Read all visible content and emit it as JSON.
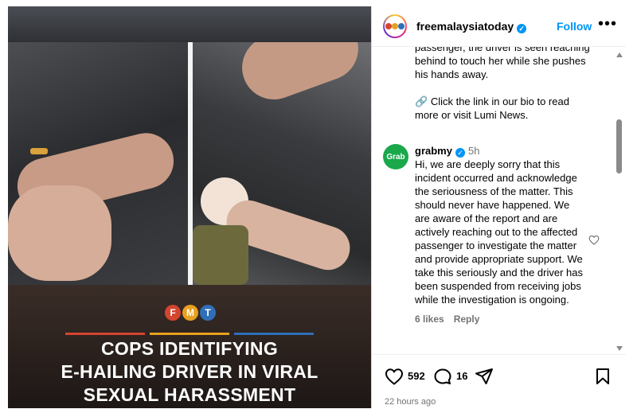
{
  "post": {
    "account": "freemalaysiatoday",
    "follow_label": "Follow",
    "more_icon": "more-horizontal-icon",
    "media": {
      "logo_letters": [
        "F",
        "M",
        "T"
      ],
      "logo_colors": [
        "#d4452f",
        "#e8a020",
        "#2f6fb8"
      ],
      "headline_lines": [
        "COPS IDENTIFYING",
        "E-HAILING DRIVER IN VIRAL",
        "SEXUAL HARASSMENT"
      ]
    },
    "caption": {
      "lines_partial": "passenger, the driver is seen reaching behind to touch her while she pushes his hands away.",
      "link_text": "Click the link in our bio to read more or visit Lumi News."
    },
    "comment": {
      "avatar_text": "Grab",
      "username": "grabmy",
      "time": "5h",
      "text": "Hi, we are deeply sorry that this incident occurred and acknowledge the seriousness of the matter. This should never have happened. We are aware of the report and are actively reaching out to the affected passenger to investigate the matter and provide appropriate support. We take this seriously and the driver has been suspended from receiving jobs while the investigation is ongoing.",
      "likes": "6 likes",
      "reply_label": "Reply"
    },
    "actions": {
      "like_count": "592",
      "comment_count": "16",
      "time_ago": "22 hours ago"
    },
    "colors": {
      "accent_blue": "#0095f6",
      "grab_green": "#1aa84b"
    }
  }
}
